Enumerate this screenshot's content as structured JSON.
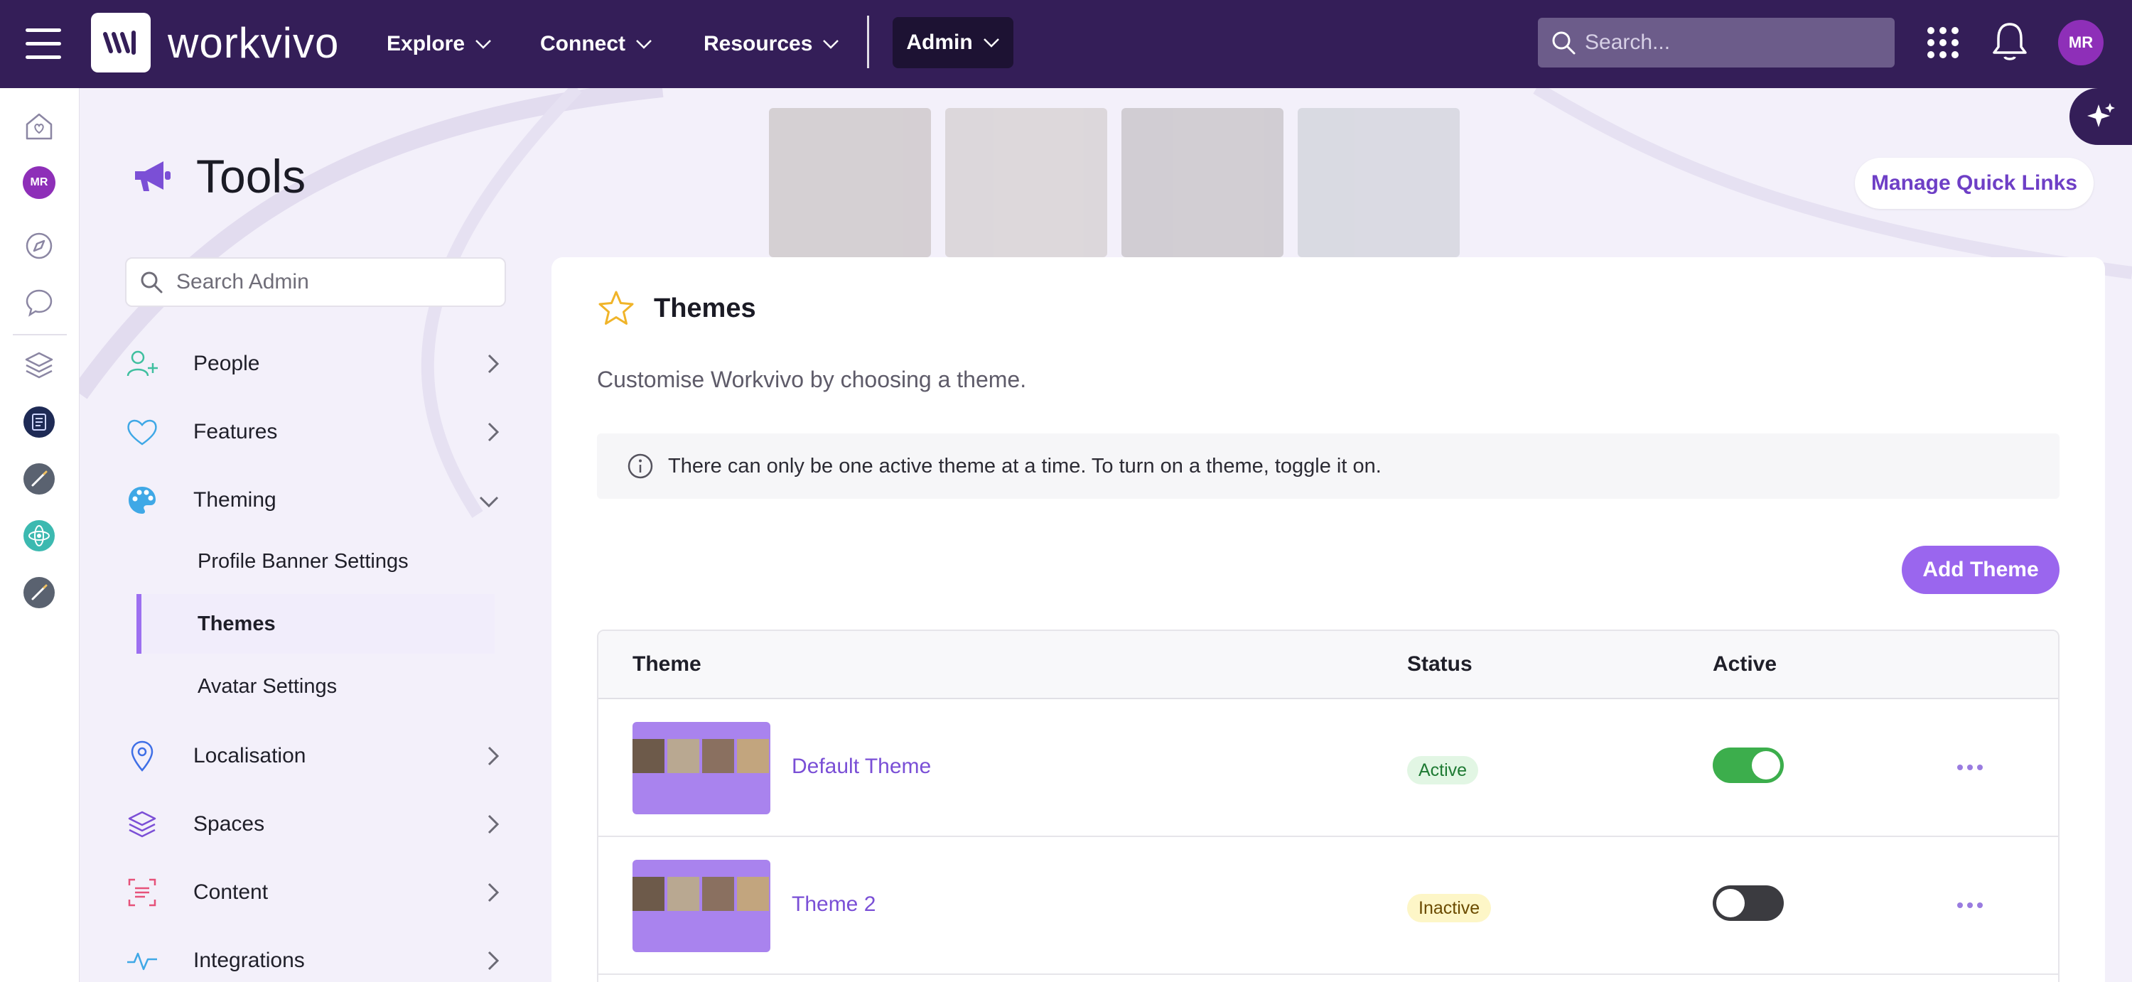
{
  "topbar": {
    "brand": "workvivo",
    "nav": [
      {
        "label": "Explore"
      },
      {
        "label": "Connect"
      },
      {
        "label": "Resources"
      }
    ],
    "admin_label": "Admin",
    "search_placeholder": "Search...",
    "user_initials": "MR",
    "bg_color": "#341e58"
  },
  "rail": {
    "user_initials": "MR"
  },
  "page": {
    "title": "Tools",
    "quick_links_label": "Manage Quick Links"
  },
  "sidebar": {
    "search_placeholder": "Search Admin",
    "items": [
      {
        "label": "People"
      },
      {
        "label": "Features"
      },
      {
        "label": "Theming"
      },
      {
        "label": "Localisation"
      },
      {
        "label": "Spaces"
      },
      {
        "label": "Content"
      },
      {
        "label": "Integrations"
      }
    ],
    "theming_sub": [
      {
        "label": "Profile Banner Settings"
      },
      {
        "label": "Themes"
      },
      {
        "label": "Avatar Settings"
      }
    ]
  },
  "main": {
    "heading": "Themes",
    "description": "Customise Workvivo by choosing a theme.",
    "info": "There can only be one active theme at a time. To turn on a theme, toggle it on.",
    "add_button": "Add Theme",
    "columns": {
      "theme": "Theme",
      "status": "Status",
      "active": "Active"
    },
    "rows": [
      {
        "name": "Default Theme",
        "status": "Active",
        "active": true
      },
      {
        "name": "Theme 2",
        "status": "Inactive",
        "active": false
      }
    ],
    "accent_color": "#9a66ee"
  }
}
